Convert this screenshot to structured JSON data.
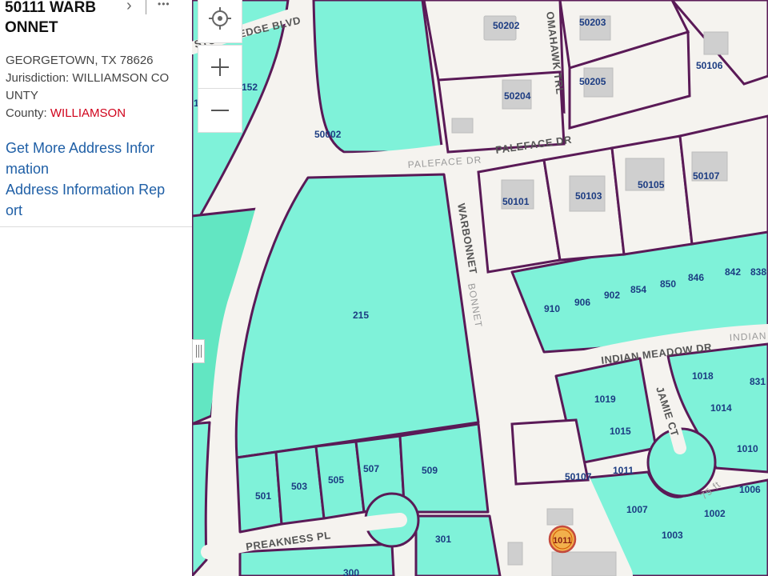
{
  "panel": {
    "title_line1": "50111 WARB",
    "title_line2": "ONNET",
    "chevron": "›",
    "more": "•••",
    "city_line": "GEORGETOWN, TX  78626",
    "jurisdiction_line1": "Jurisdiction: WILLIAMSON CO",
    "jurisdiction_line2": "UNTY",
    "county_label": "County: ",
    "county_value": "WILLIAMSON",
    "link1_line1": "Get More Address Infor",
    "link1_line2": "mation",
    "link2_line1": "Address Information Rep",
    "link2_line2": "ort"
  },
  "colors": {
    "parcel_fill": "#7ff2d9",
    "parcel_border": "#5a1a57",
    "road": "#f5f3ef",
    "link": "#1f5fa6",
    "county_value": "#d0021b"
  },
  "map": {
    "streets": {
      "stonehedge": "STONEHEDGE BLVD",
      "paleface_grey": "PALEFACE  DR",
      "paleface": "PALEFACE DR",
      "warbonnet": "WARBONNET",
      "warbonnet2": "BONNET",
      "tomahawk": "OMAHAWK TRL",
      "indian_meadow": "INDIAN MEADOW DR",
      "indian_grey": "INDIAN",
      "jamie": "JAMIE CT",
      "preakness": "PREAKNESS PL"
    },
    "scale_hint": "75 ft",
    "parcels": [
      "50202",
      "50203",
      "50106",
      "50205",
      "50204",
      "152",
      "1",
      "50002",
      "50101",
      "50103",
      "50105",
      "50107",
      "215",
      "910",
      "906",
      "902",
      "854",
      "850",
      "846",
      "842",
      "838",
      "1018",
      "831",
      "1019",
      "1014",
      "1015",
      "1010",
      "501",
      "503",
      "505",
      "507",
      "509",
      "50107",
      "1011",
      "1006",
      "1007",
      "1002",
      "1003",
      "301",
      "300"
    ],
    "marker_label": "1011"
  }
}
